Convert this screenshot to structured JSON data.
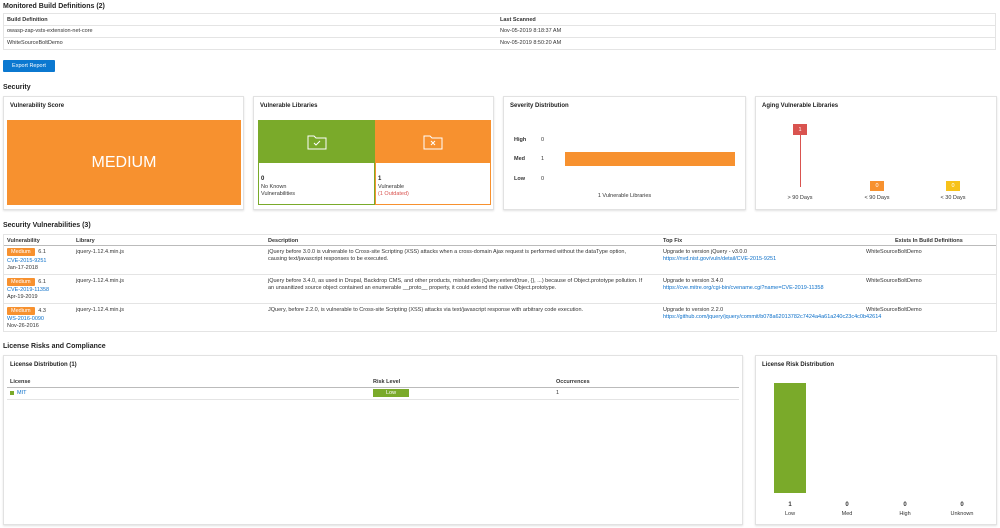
{
  "monitored": {
    "title": "Monitored Build Definitions (2)",
    "col_build": "Build Definition",
    "col_scanned": "Last Scanned",
    "rows": [
      {
        "name": "owasp-zap-vsts-extension-net-core",
        "scanned": "Nov-05-2019 8:18:37 AM"
      },
      {
        "name": "WhiteSourceBoltDemo",
        "scanned": "Nov-05-2019 8:50:20 AM"
      }
    ],
    "export_label": "Export Report"
  },
  "security": {
    "title": "Security",
    "score": {
      "title": "Vulnerability Score",
      "value": "MEDIUM",
      "color": "#f7912f"
    },
    "libraries": {
      "title": "Vulnerable Libraries",
      "ok_count": "0",
      "ok_label1": "No Known",
      "ok_label2": "Vulnerabilities",
      "vuln_count": "1",
      "vuln_label": "Vulnerable",
      "outdated": "(1 Outdated)",
      "ok_icon": "folder-check-icon",
      "vuln_icon": "folder-x-icon",
      "ok_color": "#7aaa2a",
      "vuln_color": "#f7912f"
    },
    "severity": {
      "title": "Severity Distribution",
      "rows": [
        {
          "label": "High",
          "value": 0
        },
        {
          "label": "Med",
          "value": 1
        },
        {
          "label": "Low",
          "value": 0
        }
      ],
      "footer": "1 Vulnerable Libraries"
    },
    "aging": {
      "title": "Aging Vulnerable Libraries",
      "items": [
        {
          "label": "> 90 Days",
          "value": 1,
          "color": "#d9534f"
        },
        {
          "label": "< 90 Days",
          "value": 0,
          "color": "#f7912f"
        },
        {
          "label": "< 30 Days",
          "value": 0,
          "color": "#f7c21a"
        }
      ]
    }
  },
  "vulns": {
    "title": "Security Vulnerabilities (3)",
    "headers": [
      "Vulnerability",
      "Library",
      "Description",
      "Top Fix",
      "Exists In Build Definitions"
    ],
    "rows": [
      {
        "severity": "Medium",
        "score": "6.1",
        "id": "CVE-2015-9251",
        "date": "Jan-17-2018",
        "library": "jquery-1.12.4.min.js",
        "desc1": "jQuery before 3.0.0 is vulnerable to Cross-site Scripting (XSS) attacks when a cross-domain Ajax request is performed without the dataType option,",
        "desc2": "causing text/javascript responses to be executed.",
        "fix": "Upgrade to version jQuery - v3.0.0",
        "fix_link": "https://nvd.nist.gov/vuln/detail/CVE-2015-9251",
        "build": "WhiteSourceBoltDemo"
      },
      {
        "severity": "Medium",
        "score": "6.1",
        "id": "CVE-2019-11358",
        "date": "Apr-19-2019",
        "library": "jquery-1.12.4.min.js",
        "desc1": "jQuery before 3.4.0, as used in Drupal, Backdrop CMS, and other products, mishandles jQuery.extend(true, {}, ...) because of Object.prototype pollution. If",
        "desc2": "an unsanitized source object contained an enumerable __proto__ property, it could extend the native Object.prototype.",
        "fix": "Upgrade to version 3.4.0",
        "fix_link": "https://cve.mitre.org/cgi-bin/cvename.cgi?name=CVE-2019-11358",
        "build": "WhiteSourceBoltDemo"
      },
      {
        "severity": "Medium",
        "score": "4.3",
        "id": "WS-2016-0090",
        "date": "Nov-26-2016",
        "library": "jquery-1.12.4.min.js",
        "desc1": "JQuery, before 2.2.0, is vulnerable to Cross-site Scripting (XSS) attacks via text/javascript response with arbitrary code execution.",
        "desc2": "",
        "fix": "Upgrade to version 2.2.0",
        "fix_link": "https://github.com/jquery/jquery/commit/b078a62013782c7424a4a61a240c23c4c0b42614",
        "build": "WhiteSourceBoltDemo"
      }
    ]
  },
  "license": {
    "title": "License Risks and Compliance",
    "dist_title": "License Distribution (1)",
    "headers": [
      "License",
      "Risk Level",
      "Occurrences"
    ],
    "rows": [
      {
        "name": "MIT",
        "risk": "Low",
        "occ": "1"
      }
    ],
    "risk_title": "License Risk Distribution",
    "risk_items": [
      {
        "label": "Low",
        "value": 1
      },
      {
        "label": "Med",
        "value": 0
      },
      {
        "label": "High",
        "value": 0
      },
      {
        "label": "Unknown",
        "value": 0
      }
    ],
    "green": "#7aaa2a"
  }
}
